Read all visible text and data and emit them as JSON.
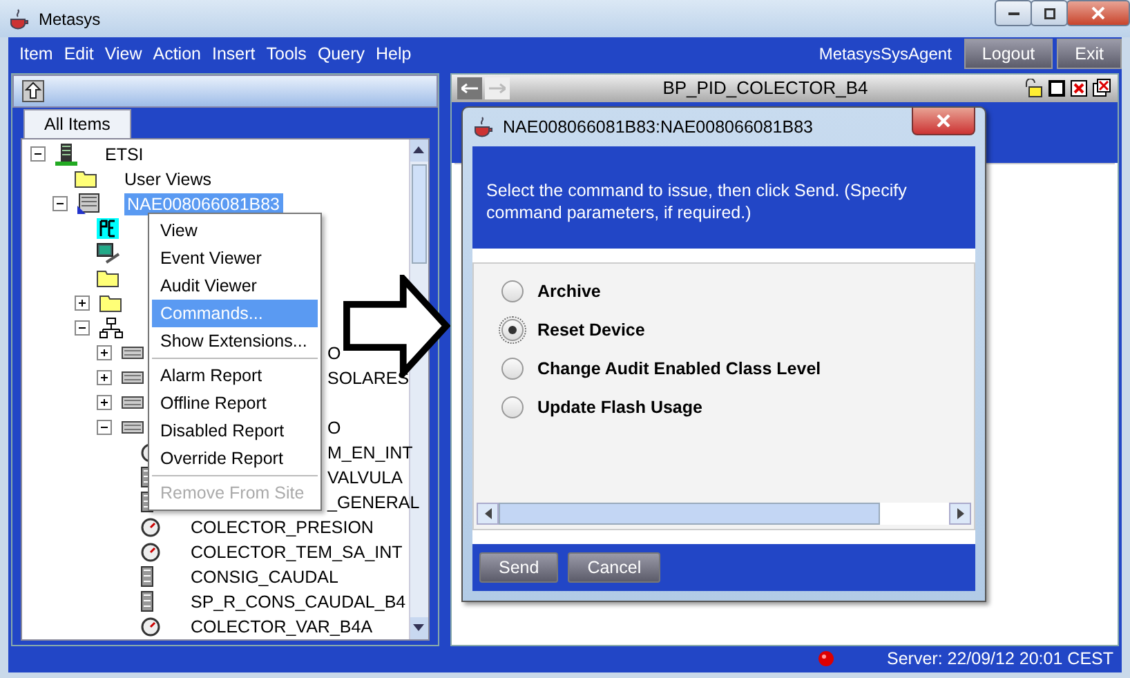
{
  "window": {
    "title": "Metasys"
  },
  "menu": [
    "Item",
    "Edit",
    "View",
    "Action",
    "Insert",
    "Tools",
    "Query",
    "Help"
  ],
  "user": "MetasysSysAgent",
  "header_buttons": [
    "Logout",
    "Exit"
  ],
  "navigation": {
    "tab": "All Items",
    "tree": [
      {
        "kind": "building",
        "label": "ETSI",
        "expanded": true,
        "selected": false,
        "children": [
          {
            "kind": "folder",
            "label": "User Views",
            "selected": false
          },
          {
            "kind": "device",
            "label": "NAE008066081B83",
            "expanded": true,
            "selected": true,
            "children": [
              {
                "kind": "bacnet"
              },
              {
                "kind": "computer"
              },
              {
                "kind": "folder"
              },
              {
                "kind": "folder",
                "expanded": false
              },
              {
                "kind": "network",
                "expanded": true,
                "children": [
                  {
                    "kind": "controller",
                    "label": "O",
                    "expanded": false,
                    "selected": false
                  },
                  {
                    "kind": "controller",
                    "label": "SOLARES",
                    "expanded": false,
                    "selected": false
                  },
                  {
                    "kind": "controller",
                    "expanded": false
                  },
                  {
                    "kind": "controller",
                    "label": "O",
                    "expanded": true,
                    "selected": false,
                    "children": [
                      {
                        "kind": "gauge",
                        "label": "M_EN_INT",
                        "selected": false
                      },
                      {
                        "kind": "meter",
                        "label": "VALVULA",
                        "selected": false
                      },
                      {
                        "kind": "meter",
                        "label": "_GENERAL",
                        "selected": false
                      },
                      {
                        "kind": "gauge",
                        "label": "COLECTOR_PRESION",
                        "selected": false
                      },
                      {
                        "kind": "gauge",
                        "label": "COLECTOR_TEM_SA_INT",
                        "selected": false
                      },
                      {
                        "kind": "meter",
                        "label": "CONSIG_CAUDAL",
                        "selected": false
                      },
                      {
                        "kind": "meter",
                        "label": "SP_R_CONS_CAUDAL_B4",
                        "selected": false
                      },
                      {
                        "kind": "gauge",
                        "label": "COLECTOR_VAR_B4A",
                        "selected": false
                      }
                    ]
                  }
                ]
              }
            ]
          }
        ]
      }
    ]
  },
  "context_menu": [
    {
      "kind": "item",
      "label": "View",
      "selected": false,
      "disabled": false
    },
    {
      "kind": "item",
      "label": "Event Viewer",
      "selected": false,
      "disabled": false
    },
    {
      "kind": "item",
      "label": "Audit Viewer",
      "selected": false,
      "disabled": false
    },
    {
      "kind": "item",
      "label": "Commands...",
      "selected": true,
      "disabled": false
    },
    {
      "kind": "item",
      "label": "Show Extensions...",
      "selected": false,
      "disabled": false
    },
    {
      "kind": "separator"
    },
    {
      "kind": "item",
      "label": "Alarm Report",
      "selected": false,
      "disabled": false
    },
    {
      "kind": "item",
      "label": "Offline Report",
      "selected": false,
      "disabled": false
    },
    {
      "kind": "item",
      "label": "Disabled Report",
      "selected": false,
      "disabled": false
    },
    {
      "kind": "item",
      "label": "Override Report",
      "selected": false,
      "disabled": false
    },
    {
      "kind": "separator"
    },
    {
      "kind": "item",
      "label": "Remove From Site",
      "selected": false,
      "disabled": true
    }
  ],
  "frame": {
    "title": "BP_PID_COLECTOR_B4"
  },
  "dialog": {
    "title": "NAE008066081B83:NAE008066081B83",
    "instructions": "Select the command to issue, then click Send. (Specify command parameters, if required.)",
    "commands": [
      {
        "label": "Archive",
        "selected": false
      },
      {
        "label": "Reset Device",
        "selected": true
      },
      {
        "label": "Change Audit Enabled Class Level",
        "selected": false
      },
      {
        "label": "Update Flash Usage",
        "selected": false
      }
    ],
    "buttons": [
      "Send",
      "Cancel"
    ]
  },
  "status_bar": {
    "server_time": "Server: 22/09/12 20:01 CEST"
  }
}
